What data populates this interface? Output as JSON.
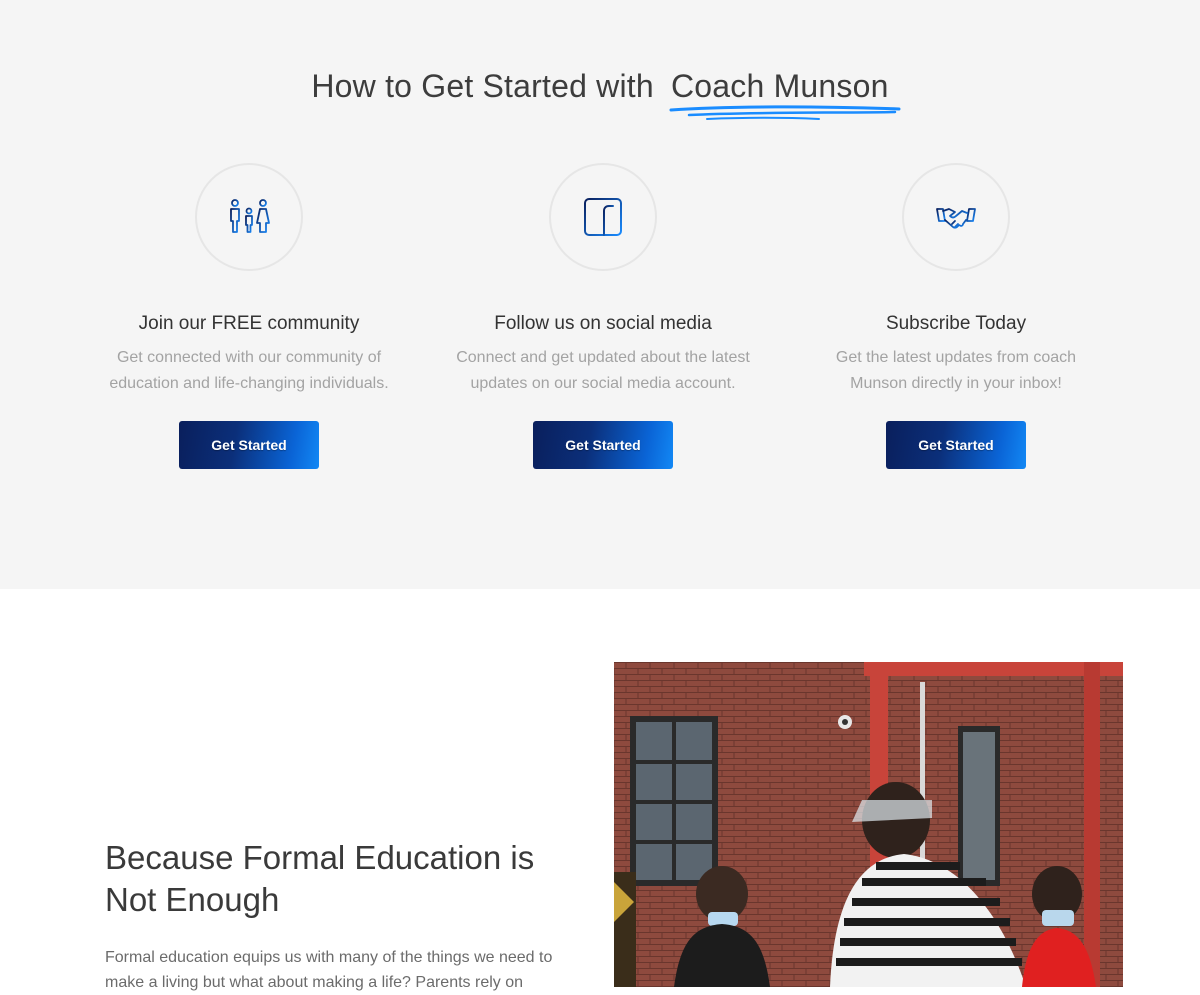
{
  "header": {
    "title_prefix": "How to Get Started with",
    "title_highlight": "Coach Munson",
    "accent_color": "#1a8cff"
  },
  "steps": [
    {
      "icon": "family-icon",
      "title": "Join our FREE community",
      "text": "Get connected with our community of education and life-changing individuals.",
      "button": "Get Started"
    },
    {
      "icon": "facebook-icon",
      "title": "Follow us on social media",
      "text": "Connect and get updated about the latest updates on our social media account.",
      "button": "Get Started"
    },
    {
      "icon": "handshake-icon",
      "title": "Subscribe Today",
      "text": "Get the latest updates from coach Munson directly in your inbox!",
      "button": "Get Started"
    }
  ],
  "about": {
    "heading": "Because Formal Education is Not Enough",
    "text": "Formal education equips us with many of the things we need to make a living but what about making a life? Parents rely on"
  }
}
